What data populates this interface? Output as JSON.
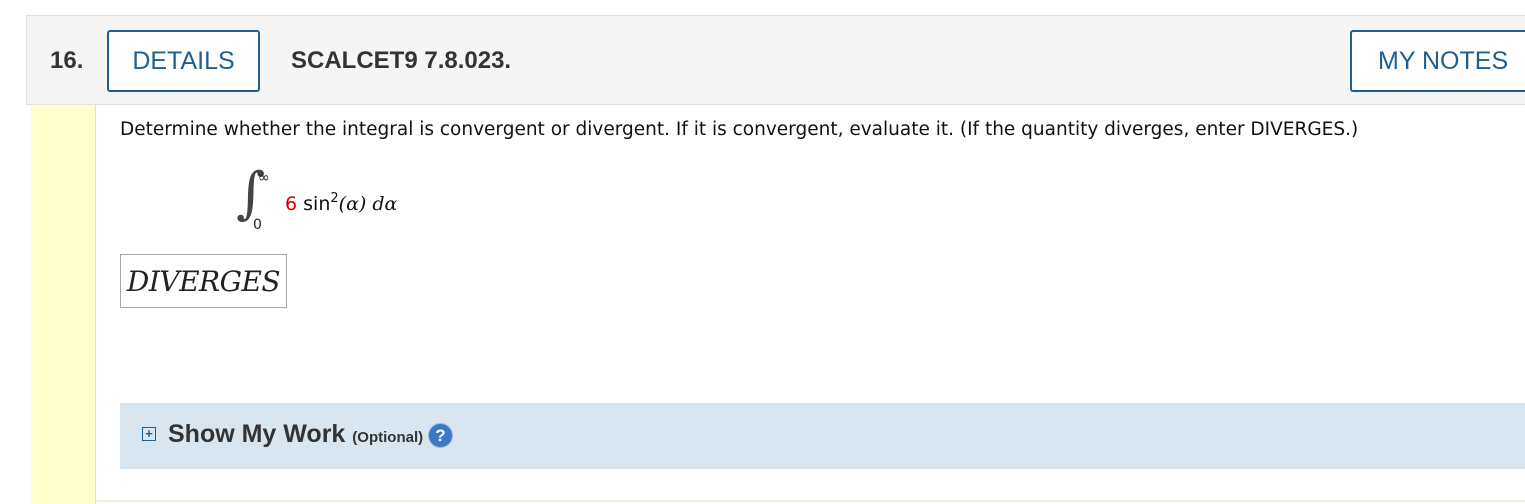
{
  "question": {
    "number": "16.",
    "details_label": "DETAILS",
    "code": "SCALCET9 7.8.023.",
    "notes_label": "MY NOTES",
    "prompt": "Determine whether the integral is convergent or divergent. If it is convergent, evaluate it. (If the quantity diverges, enter DIVERGES.)"
  },
  "integral": {
    "upper": "∞",
    "lower": "0",
    "coefficient": "6",
    "function": "sin",
    "power": "2",
    "argument": "(α)",
    "differential": "dα"
  },
  "answer": {
    "value": "DIVERGES"
  },
  "show_work": {
    "expand_symbol": "+",
    "title": "Show My Work",
    "optional": "(Optional)",
    "help_symbol": "?"
  },
  "colors": {
    "accent": "#1f5f8e",
    "side_strip": "#ffffcc",
    "work_bar": "#d9e6f0",
    "coefficient_red": "#cc0000"
  }
}
